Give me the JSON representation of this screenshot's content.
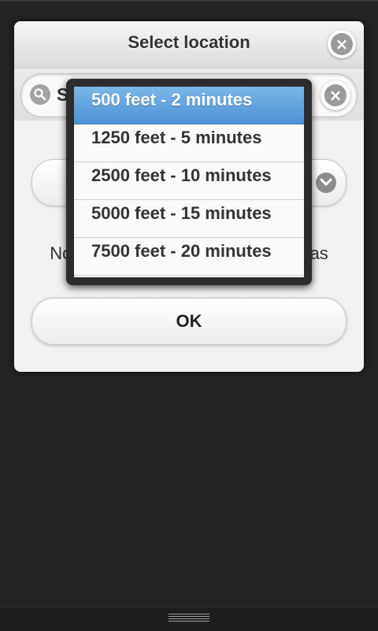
{
  "dialog": {
    "title": "Select location",
    "search": {
      "value": "S"
    },
    "message": "No",
    "message_tail": "as",
    "ok_label": "OK"
  },
  "dropdown": {
    "options": [
      {
        "label": "500 feet - 2 minutes",
        "selected": true
      },
      {
        "label": "1250 feet - 5 minutes",
        "selected": false
      },
      {
        "label": "2500 feet - 10 minutes",
        "selected": false
      },
      {
        "label": "5000 feet - 15 minutes",
        "selected": false
      },
      {
        "label": "7500 feet - 20 minutes",
        "selected": false
      }
    ]
  },
  "icons": {
    "close": "close-icon",
    "search": "search-icon",
    "clear": "clear-icon",
    "chevron": "chevron-down-icon",
    "menu": "menu-handle-icon"
  },
  "colors": {
    "selected_option": "#4d93d6",
    "background": "#242424"
  }
}
